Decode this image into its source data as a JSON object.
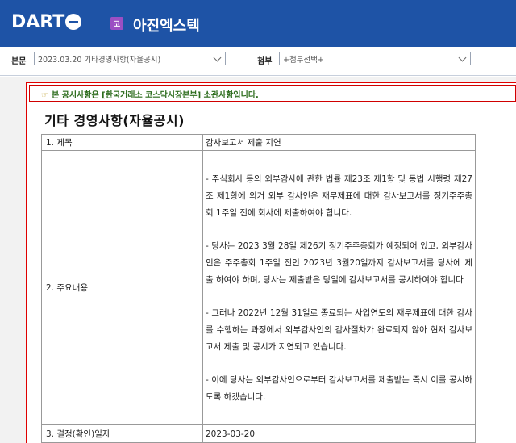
{
  "header": {
    "logo_text": "DART",
    "market_badge": "코",
    "company_name": "아진엑스텍"
  },
  "toolbar": {
    "main_label": "본문",
    "main_select_value": "2023.03.20  기타경영사항(자율공시)",
    "attach_label": "첨부",
    "attach_select_value": "+첨부선택+"
  },
  "notice": {
    "text": "본 공시사항은 [한국거래소 코스닥시장본부] 소관사항입니다."
  },
  "document": {
    "title": "기타 경영사항(자율공시)",
    "rows": [
      {
        "key": "1. 제목",
        "value": "감사보고서 제출 지연"
      },
      {
        "key": "2. 주요내용",
        "paragraphs": [
          "- 주식회사 등의 외부감사에 관한 법률 제23조 제1항 및 동법 시행령 제27조 제1항에 의거 외부 감사인은 재무제표에 대한 감사보고서를 정기주주총회 1주일 전에 회사에 제출하여야 합니다.",
          "- 당사는 2023 3월 28일 제26기 정기주주총회가 예정되어 있고, 외부감사인은 주주총회 1주일 전인 2023년 3월20일까지 감사보고서를 당사에 제출 하여야 하며, 당사는 제출받은 당일에 감사보고서를 공시하여야 합니다",
          "- 그러나 2022년 12월 31일로 종료되는 사업연도의 재무제표에 대한 감사를 수행하는 과정에서 외부감사인의 감사절차가 완료되지 않아 현재 감사보고서 제출 및 공시가 지연되고 있습니다.",
          "- 이에 당사는 외부감사인으로부터 감사보고서를 제출받는 즉시 이를 공시하도록 하겠습니다."
        ]
      },
      {
        "key": "3. 결정(확인)일자",
        "value": "2023-03-20"
      }
    ]
  },
  "colors": {
    "header_bg": "#1e53a6",
    "notice_border": "#d00000",
    "notice_text": "#2b6b1b",
    "market_badge": "#9b4fc3"
  },
  "icons": {
    "logo_mark": "dart-logo-icon",
    "notice_pointer": "pointing-hand-icon",
    "select_arrow": "chevron-down-icon"
  }
}
